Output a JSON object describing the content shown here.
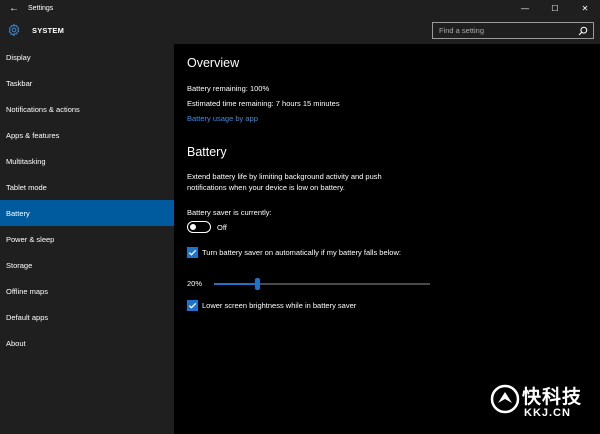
{
  "window": {
    "title": "Settings",
    "minimize": "—",
    "maximize": "☐",
    "close": "✕",
    "back": "←"
  },
  "header": {
    "section": "SYSTEM",
    "search_placeholder": "Find a setting"
  },
  "sidebar": {
    "items": [
      {
        "label": "Display"
      },
      {
        "label": "Taskbar"
      },
      {
        "label": "Notifications & actions"
      },
      {
        "label": "Apps & features"
      },
      {
        "label": "Multitasking"
      },
      {
        "label": "Tablet mode"
      },
      {
        "label": "Battery",
        "active": true
      },
      {
        "label": "Power & sleep"
      },
      {
        "label": "Storage"
      },
      {
        "label": "Offline maps"
      },
      {
        "label": "Default apps"
      },
      {
        "label": "About"
      }
    ]
  },
  "overview": {
    "title": "Overview",
    "remaining": "Battery remaining: 100%",
    "time": "Estimated time remaining: 7 hours 15 minutes",
    "usage_link": "Battery usage by app"
  },
  "battery": {
    "title": "Battery",
    "desc_line1": "Extend battery life by limiting background activity and push",
    "desc_line2": "notifications when your device is low on battery.",
    "saver_label": "Battery saver is currently:",
    "toggle_state": "Off",
    "auto_checkbox": "Turn battery saver on automatically if my battery falls below:",
    "slider_value": "20%",
    "slider_fraction": 0.2,
    "brightness_checkbox": "Lower screen brightness while in battery saver"
  },
  "watermark": {
    "cn": "快科技",
    "en": "KKJ.CN"
  },
  "colors": {
    "accent": "#005a9e",
    "link": "#3a8fe0",
    "checkbox": "#1e73c8",
    "sidebar": "#1f1f1f",
    "main": "#000000"
  }
}
